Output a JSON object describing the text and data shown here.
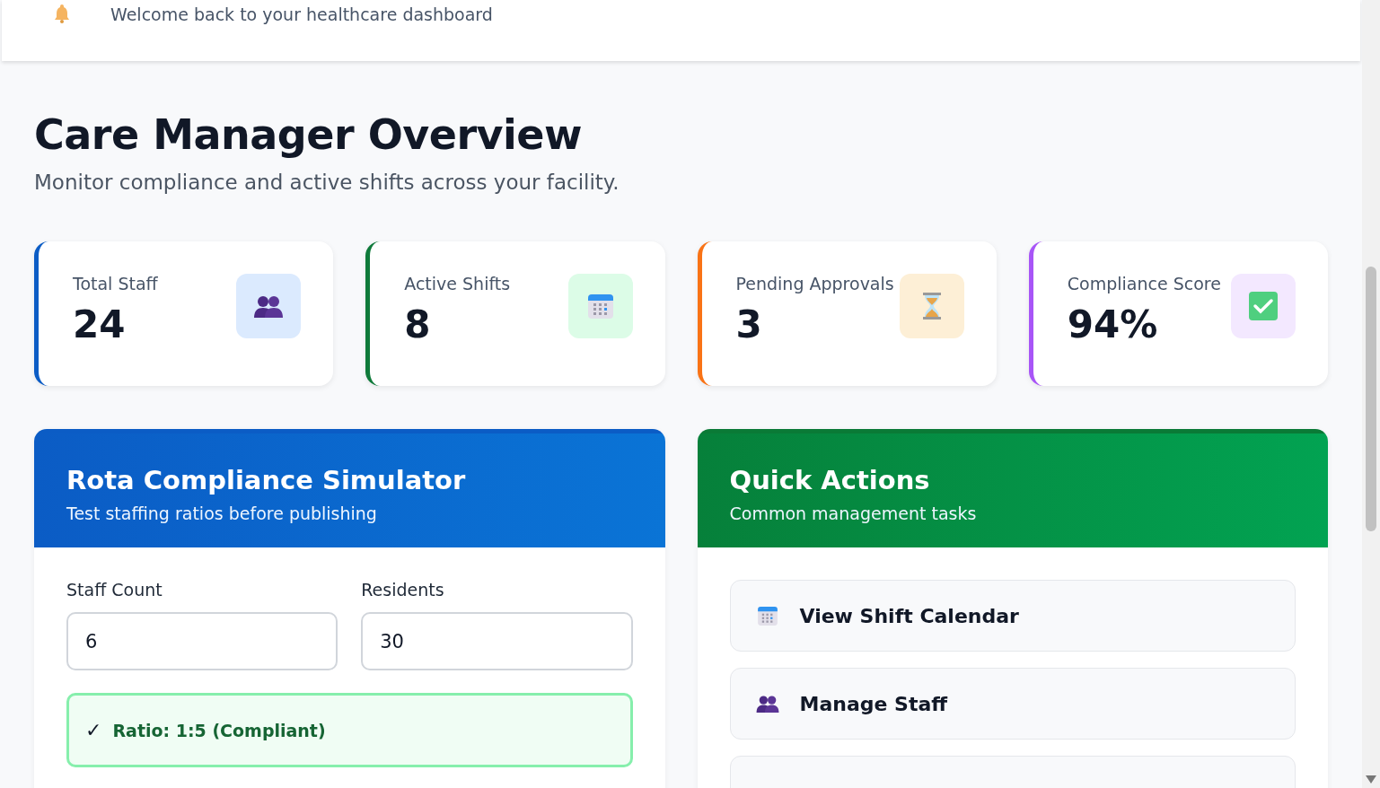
{
  "header": {
    "welcome": "Welcome back to your healthcare dashboard"
  },
  "page": {
    "title": "Care Manager Overview",
    "subtitle": "Monitor compliance and active shifts across your facility."
  },
  "stats": [
    {
      "label": "Total Staff",
      "value": "24",
      "kind": "people",
      "color": "#0b5cc5"
    },
    {
      "label": "Active Shifts",
      "value": "8",
      "kind": "calendar",
      "color": "#0f7a3a"
    },
    {
      "label": "Pending Approvals",
      "value": "3",
      "kind": "hourglass",
      "color": "#f97316"
    },
    {
      "label": "Compliance Score",
      "value": "94%",
      "kind": "check",
      "color": "#a855f7"
    }
  ],
  "simulator": {
    "title": "Rota Compliance Simulator",
    "subtitle": "Test staffing ratios before publishing",
    "fields": [
      {
        "label": "Staff Count",
        "value": "6"
      },
      {
        "label": "Residents",
        "value": "30"
      }
    ],
    "result": {
      "kind": "compliant",
      "mark": "✓",
      "text": "Ratio: 1:5 (Compliant)"
    }
  },
  "quick_actions": {
    "title": "Quick Actions",
    "subtitle": "Common management tasks",
    "items": [
      {
        "label": "View Shift Calendar",
        "kind": "calendar"
      },
      {
        "label": "Manage Staff",
        "kind": "people"
      },
      {
        "kind": "blank"
      }
    ]
  }
}
